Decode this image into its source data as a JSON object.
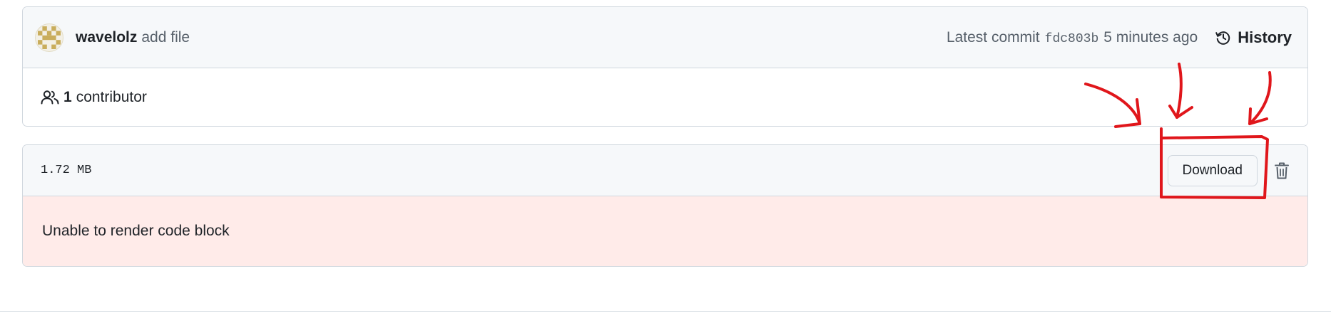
{
  "commit": {
    "author": "wavelolz",
    "message": "add file",
    "latest_commit_label": "Latest commit",
    "sha": "fdc803b",
    "time_ago": "5 minutes ago",
    "history_label": "History"
  },
  "contributors": {
    "count": "1",
    "label": "contributor"
  },
  "file": {
    "size": "1.72 MB",
    "download_label": "Download",
    "error_message": "Unable to render code block"
  },
  "colors": {
    "annotation": "#e0161b",
    "error_bg": "#ffebe9",
    "header_bg": "#f6f8fa",
    "border": "#d0d7de"
  },
  "icons": [
    "avatar-identicon",
    "history-icon",
    "people-icon",
    "trash-icon"
  ]
}
